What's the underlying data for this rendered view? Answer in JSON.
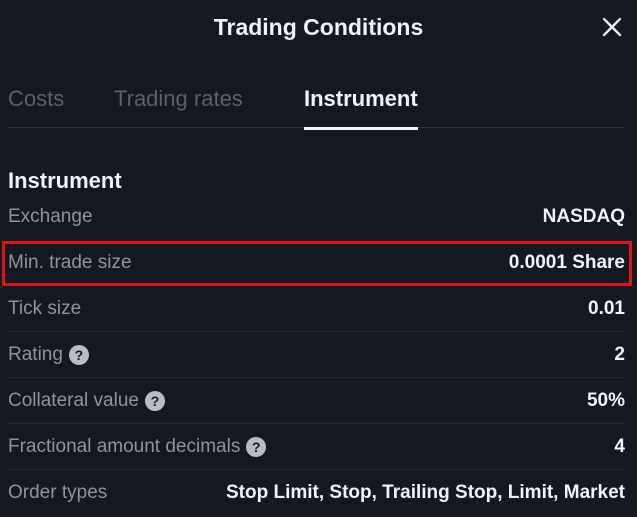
{
  "dialog": {
    "title": "Trading Conditions"
  },
  "tabs": [
    {
      "label": "Costs",
      "active": false
    },
    {
      "label": "Trading rates",
      "active": false
    },
    {
      "label": "Instrument",
      "active": true
    }
  ],
  "section": {
    "title": "Instrument"
  },
  "rows": [
    {
      "label": "Exchange",
      "value": "NASDAQ",
      "help": false
    },
    {
      "label": "Min. trade size",
      "value": "0.0001 Share",
      "help": false,
      "highlighted": true
    },
    {
      "label": "Tick size",
      "value": "0.01",
      "help": false
    },
    {
      "label": "Rating",
      "value": "2",
      "help": true
    },
    {
      "label": "Collateral value",
      "value": "50%",
      "help": true
    },
    {
      "label": "Fractional amount decimals",
      "value": "4",
      "help": true
    },
    {
      "label": "Order types",
      "value": "Stop Limit, Stop, Trailing Stop, Limit, Market",
      "help": false
    }
  ],
  "icons": {
    "close": "close-icon",
    "help": "?"
  },
  "colors": {
    "background": "#141821",
    "highlight": "#e01414",
    "active_tab": "#f1f3f6",
    "inactive_tab": "#5a606c"
  }
}
